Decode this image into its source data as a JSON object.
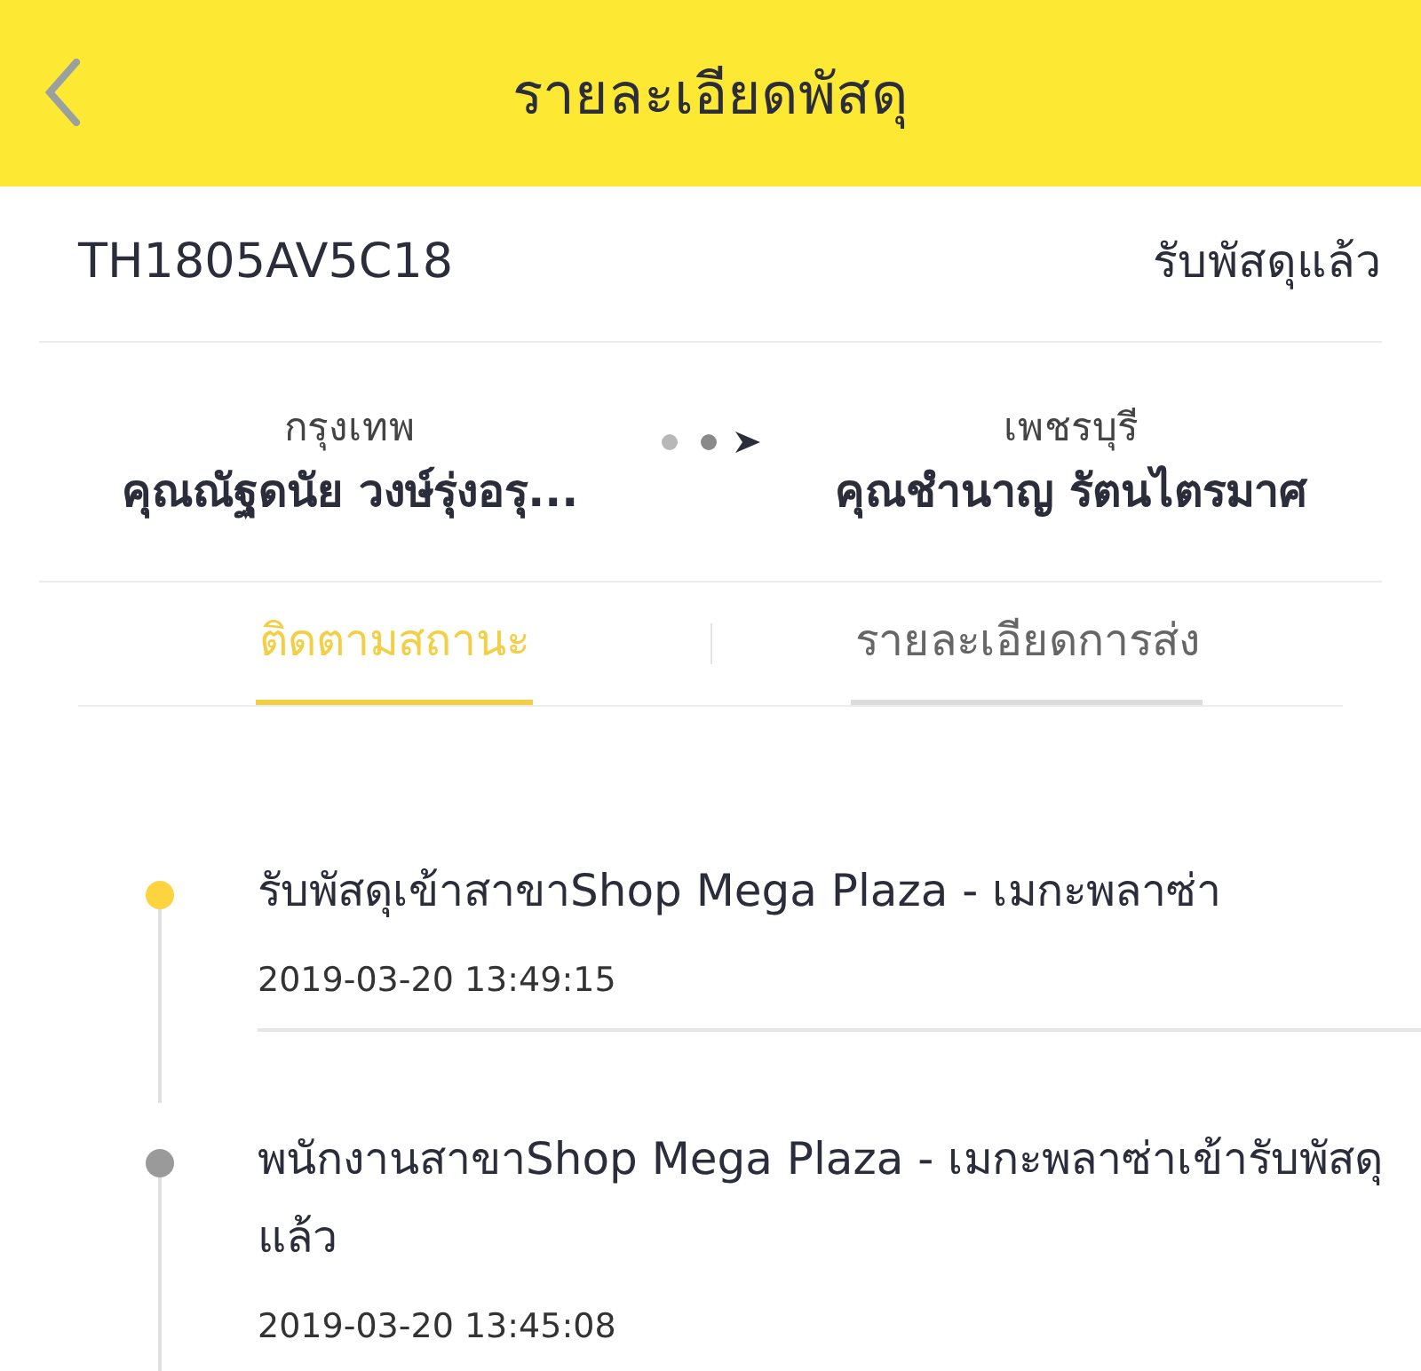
{
  "header": {
    "title": "รายละเอียดพัสดุ"
  },
  "parcel": {
    "tracking_number": "TH1805AV5C18",
    "status": "รับพัสดุแล้ว"
  },
  "route": {
    "sender": {
      "province": "กรุงเทพ",
      "name": "คุณณัฐดนัย  วงษ์รุ่งอรุ..."
    },
    "receiver": {
      "province": "เพชรบุรี",
      "name": "คุณชำนาญ รัตนไตรมาศ"
    }
  },
  "tabs": [
    {
      "label": "ติดตามสถานะ",
      "selected": true
    },
    {
      "label": "รายละเอียดการส่ง",
      "selected": false
    }
  ],
  "timeline": [
    {
      "text": "รับพัสดุเข้าสาขาShop Mega Plaza - เมกะพลาซ่า",
      "time": "2019-03-20 13:49:15",
      "current": true
    },
    {
      "text": "พนักงานสาขาShop Mega Plaza - เมกะพลาซ่าเข้ารับพัสดุแล้ว",
      "time": "2019-03-20 13:45:08",
      "current": false
    }
  ]
}
